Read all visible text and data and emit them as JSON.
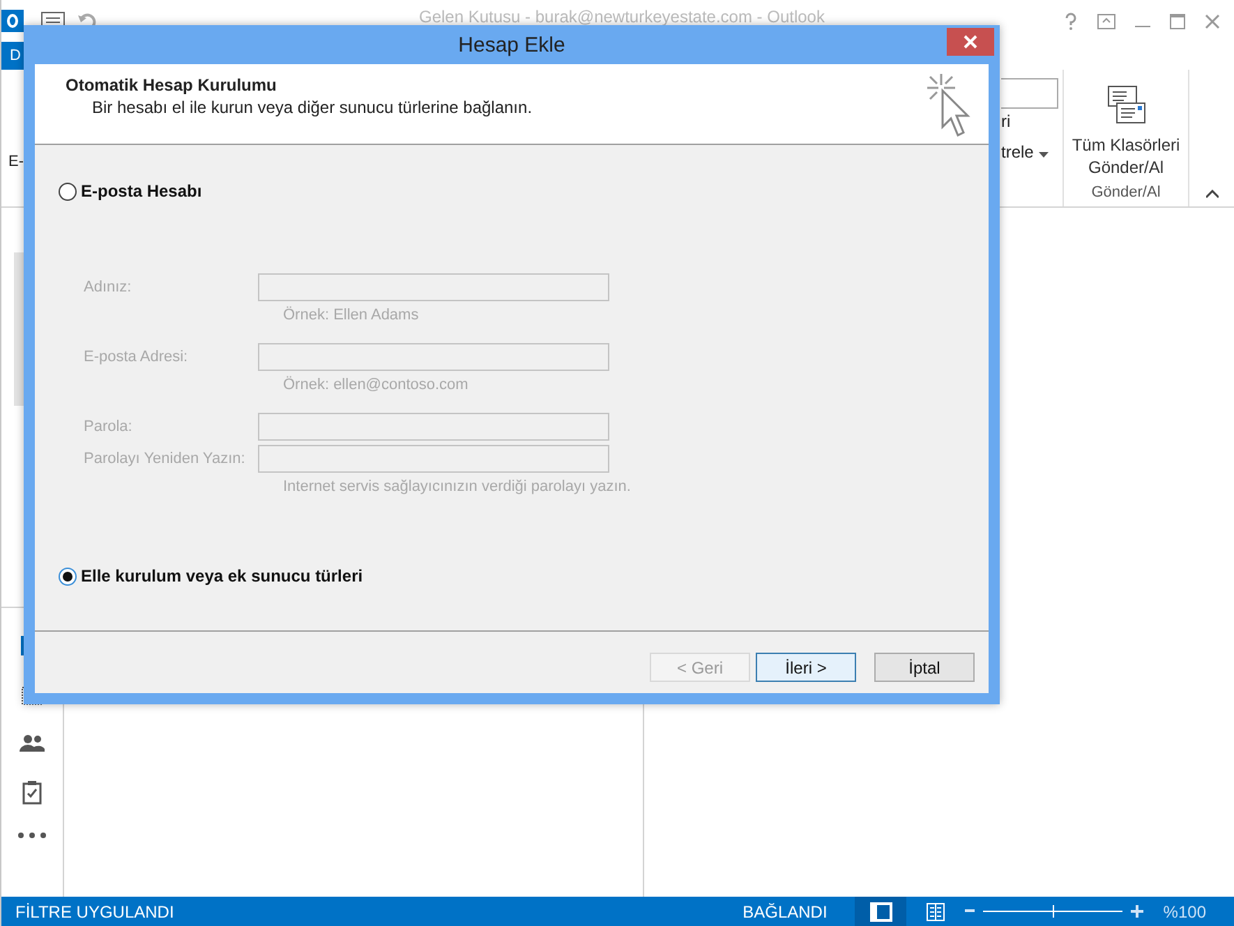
{
  "outlook": {
    "title": "Gelen Kutusu - burak@newturkeyestate.com - Outlook",
    "ribbon_tab": "D",
    "ribbon_left_text": "E-",
    "ribbon_fragment_1": "ri",
    "ribbon_fragment_2": "trele",
    "send_receive_button": "Tüm Klasörleri Gönder/Al",
    "group_label": "Gönder/Al"
  },
  "dialog": {
    "title": "Hesap Ekle",
    "heading": "Otomatik Hesap Kurulumu",
    "subheading": "Bir hesabı el ile kurun veya diğer sunucu türlerine bağlanın.",
    "options": [
      {
        "label": "E-posta Hesabı",
        "selected": false
      },
      {
        "label": "Elle kurulum veya ek sunucu türleri",
        "selected": true
      }
    ],
    "fields": [
      {
        "label": "Adınız:",
        "hint": "Örnek: Ellen Adams",
        "disabled": true
      },
      {
        "label": "E-posta Adresi:",
        "hint": "Örnek: ellen@contoso.com",
        "disabled": true
      },
      {
        "label": "Parola:",
        "disabled": true
      },
      {
        "label": "Parolayı Yeniden Yazın:",
        "hint": "Internet servis sağlayıcınızın verdiği parolayı yazın.",
        "disabled": true
      }
    ],
    "buttons": [
      {
        "label": "< Geri",
        "disabled": true,
        "default": false
      },
      {
        "label": "İleri >",
        "disabled": false,
        "default": true
      },
      {
        "label": "İptal",
        "disabled": false,
        "default": false
      }
    ]
  },
  "status_bar": {
    "left": "FİLTRE UYGULANDI",
    "connection": "BAĞLANDI",
    "zoom": "%100",
    "zoom_slider": {
      "level": 0.5
    }
  }
}
